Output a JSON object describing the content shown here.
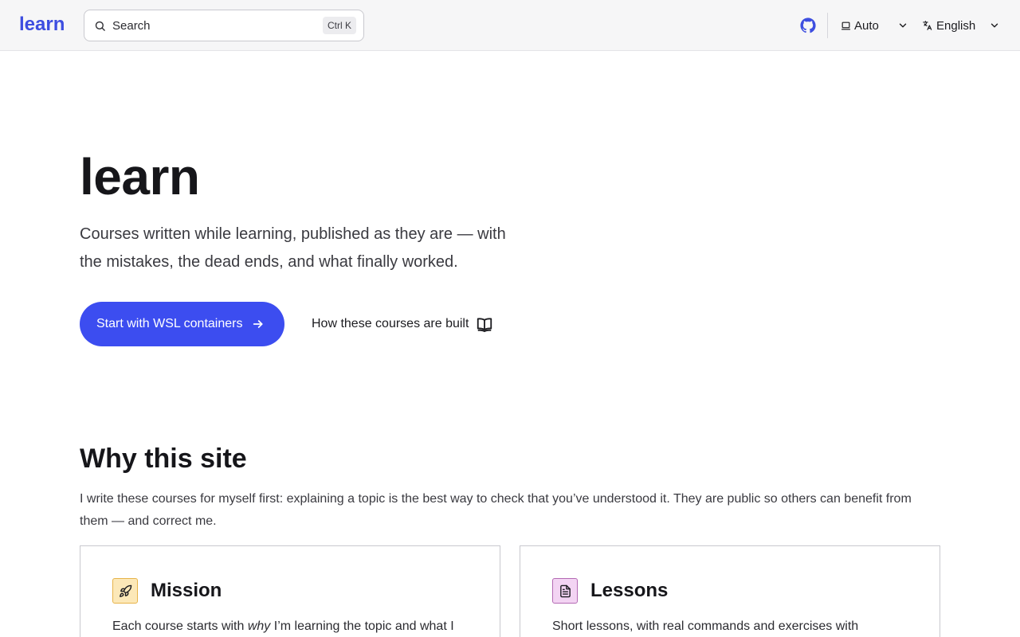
{
  "header": {
    "logo": "learn",
    "search_label": "Search",
    "search_shortcut": "Ctrl K",
    "appearance_label": "Auto",
    "language_label": "English",
    "icons": [
      "search-icon",
      "github-icon",
      "laptop-icon",
      "chevron-down-icon",
      "translate-icon"
    ]
  },
  "hero": {
    "title": "learn",
    "tagline": "Courses written while learning, published as they are — with the mistakes, the dead ends, and what finally worked.",
    "cta_label": "Start with WSL containers",
    "secondary_label": "How these courses are built"
  },
  "why": {
    "title": "Why this site",
    "text": "I write these courses for myself first: explaining a topic is the best way to check that you’ve understood it. They are public so others can benefit from them — and correct me."
  },
  "cards": [
    {
      "title": "Mission",
      "text_before": "Each course starts with ",
      "text_em": "why",
      "text_after": " I’m learning the topic and what I",
      "icon": "rocket-icon"
    },
    {
      "title": "Lessons",
      "text": "Short lessons, with real commands and exercises with",
      "icon": "document-icon"
    }
  ],
  "colors": {
    "accent": "#3c4df0",
    "logo": "#3d4ee0",
    "mission_icon_bg": "#fce8b8",
    "lessons_icon_bg": "#f3d4f3"
  }
}
